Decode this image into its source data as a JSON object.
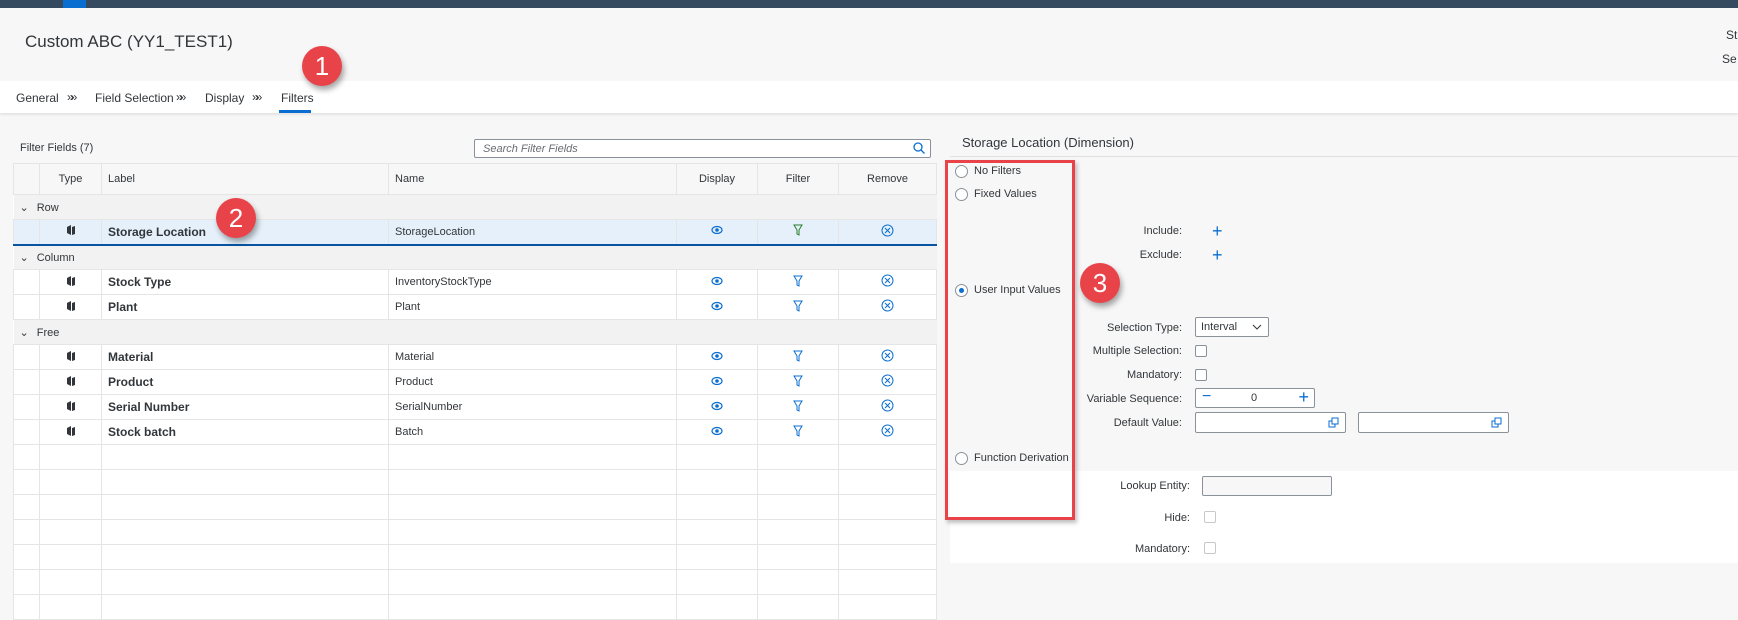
{
  "header": {
    "title": "Custom ABC (YY1_TEST1)",
    "right_line1": "St",
    "right_line2": "Se"
  },
  "steps": [
    {
      "label": "General"
    },
    {
      "label": "Field Selection"
    },
    {
      "label": "Display"
    },
    {
      "label": "Filters",
      "active": true
    }
  ],
  "step_separator": "»»",
  "filter_fields": {
    "title": "Filter Fields (7)",
    "search_placeholder": "Search Filter Fields",
    "columns": [
      "Type",
      "Label",
      "Name",
      "Display",
      "Filter",
      "Remove"
    ],
    "groups": [
      {
        "name": "Row",
        "rows": [
          {
            "label": "Storage Location",
            "name": "StorageLocation",
            "selected": true
          }
        ]
      },
      {
        "name": "Column",
        "rows": [
          {
            "label": "Stock Type",
            "name": "InventoryStockType"
          },
          {
            "label": "Plant",
            "name": "Plant"
          }
        ]
      },
      {
        "name": "Free",
        "rows": [
          {
            "label": "Material",
            "name": "Material"
          },
          {
            "label": "Product",
            "name": "Product"
          },
          {
            "label": "Serial Number",
            "name": "SerialNumber"
          },
          {
            "label": "Stock batch",
            "name": "Batch"
          }
        ]
      }
    ]
  },
  "panel": {
    "title": "Storage Location (Dimension)",
    "radios": [
      {
        "label": "No Filters"
      },
      {
        "label": "Fixed Values"
      },
      {
        "label": "User Input Values",
        "selected": true
      },
      {
        "label": "Function Derivation"
      }
    ],
    "include": "Include:",
    "exclude": "Exclude:",
    "selection_type_label": "Selection Type:",
    "selection_type_value": "Interval",
    "multiple_selection": "Multiple Selection:",
    "mandatory": "Mandatory:",
    "variable_sequence": "Variable Sequence:",
    "variable_sequence_value": "0",
    "default_value": "Default Value:",
    "lookup_entity": "Lookup Entity:",
    "hide": "Hide:",
    "mandatory2": "Mandatory:"
  },
  "annotations": [
    "1",
    "2",
    "3"
  ],
  "colors": {
    "shell": "#354a5f",
    "accent": "#0a6ed1",
    "annotation": "#e9434a",
    "selected_filter": "#2b7d2b"
  }
}
